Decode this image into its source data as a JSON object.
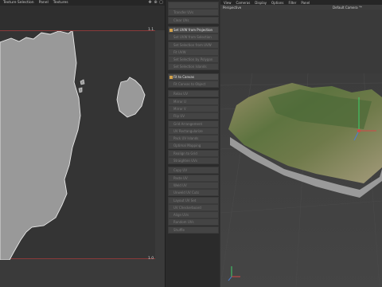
{
  "uv_editor": {
    "menu": [
      "Texture Selection",
      "Panel",
      "Textures"
    ],
    "tick_top": "1.1",
    "tick_bottom": "1.0"
  },
  "commands": {
    "buttons": [
      {
        "label": "",
        "active": false
      },
      {
        "label": "Transfer UVs",
        "active": false
      },
      {
        "label": "Clear UVs",
        "active": false
      },
      {
        "label": "Set UVW from Projection",
        "active": true,
        "icon": "projection-icon"
      },
      {
        "label": "Set UVW from Selection",
        "active": false
      },
      {
        "label": "Set Selection from UVW",
        "active": false
      },
      {
        "label": "Fit UVW",
        "active": false
      },
      {
        "label": "Set Selection by Polygon",
        "active": false
      },
      {
        "label": "Set Selection Islands",
        "active": false
      },
      {
        "label": "Fit to Canvas",
        "active": true,
        "icon": "fit-canvas-icon"
      },
      {
        "label": "Fit Canvas to Object",
        "active": false
      },
      {
        "label": "Relax UV",
        "active": false
      },
      {
        "label": "Mirror U",
        "active": false
      },
      {
        "label": "Mirror V",
        "active": false
      },
      {
        "label": "Flip UV",
        "active": false
      },
      {
        "label": "Grid Arrangement",
        "active": false
      },
      {
        "label": "UV Rectangularize",
        "active": false
      },
      {
        "label": "Pack UV Islands",
        "active": false
      },
      {
        "label": "Optimal Mapping",
        "active": false
      },
      {
        "label": "Realign to Grid",
        "active": false
      },
      {
        "label": "Straighten UVs",
        "active": false
      },
      {
        "label": "Copy UV",
        "active": false
      },
      {
        "label": "Paste UV",
        "active": false
      },
      {
        "label": "Weld UV",
        "active": false
      },
      {
        "label": "Unweld UV Cuts",
        "active": false
      },
      {
        "label": "Layout UV Set",
        "active": false
      },
      {
        "label": "UV Checkerboard",
        "active": false
      },
      {
        "label": "Align UVs",
        "active": false
      },
      {
        "label": "Random UVs",
        "active": false
      },
      {
        "label": "Shuffle",
        "active": false
      }
    ]
  },
  "viewport": {
    "menu": [
      "View",
      "Cameras",
      "Display",
      "Options",
      "Filter",
      "Panel"
    ],
    "view_name": "Perspective",
    "camera": "Default Camera °*"
  },
  "colors": {
    "uv_border": "#8a3a3a",
    "axis_x": "#d24848",
    "axis_y": "#3fd06a",
    "axis_z": "#4a7fd8"
  }
}
